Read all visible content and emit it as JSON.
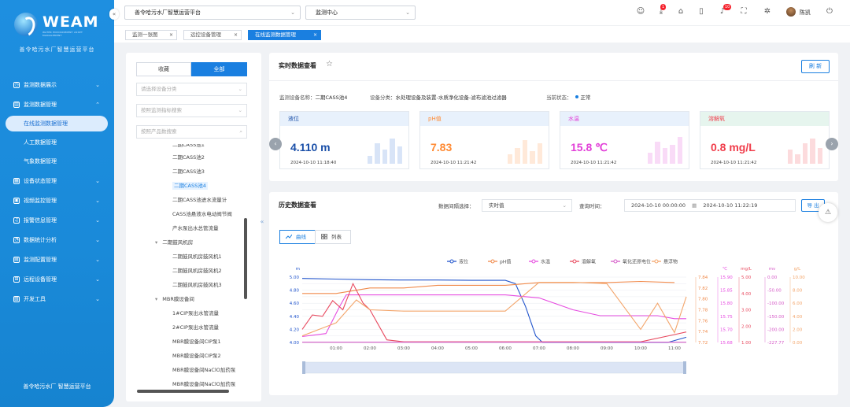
{
  "sidebar": {
    "logo_text": "WEAM",
    "logo_sub": "WATER ENVIRONMENT ASSET MANAGEMENT",
    "brand": "善令哈污水厂智慧运营平台",
    "menu": [
      {
        "label": "监测数据展示",
        "icon": "◷"
      },
      {
        "label": "监测数据管理",
        "icon": "▥",
        "expanded": true,
        "children": [
          "在线监测数据管理",
          "人工数据管理",
          "气象数据管理"
        ]
      },
      {
        "label": "设备状态管理",
        "icon": "▦"
      },
      {
        "label": "视频监控管理",
        "icon": "▣"
      },
      {
        "label": "报警信息管理",
        "icon": "♫"
      },
      {
        "label": "数据统计分析",
        "icon": "◔"
      },
      {
        "label": "监测配置管理",
        "icon": "▤"
      },
      {
        "label": "远程设备管理",
        "icon": "⊞"
      },
      {
        "label": "开发工具",
        "icon": "▧"
      }
    ],
    "active_child": "在线监测数据管理",
    "footer": "善令哈污水厂 智慧运营平台"
  },
  "topbar": {
    "site_select": "善令哈污水厂智慧运营平台",
    "module_select": "监测中心",
    "badge_download": "1",
    "badge_bell": "10",
    "username": "陈凯"
  },
  "tabs": [
    "监测一张图",
    "远控设备管理",
    "在线监测数据管理"
  ],
  "active_tab": "在线监测数据管理",
  "leftpanel": {
    "seg_fav": "收藏",
    "seg_all": "全部",
    "filter1": "请选择设备分类",
    "filter2": "按照监测指标搜索",
    "filter3": "按照产品数搜索",
    "tree": [
      {
        "label": "二期CASS池1",
        "indent": 2,
        "partial": true
      },
      {
        "label": "二期CASS池2",
        "indent": 2
      },
      {
        "label": "二期CASS池3",
        "indent": 2
      },
      {
        "label": "二期CASS池4",
        "indent": 2,
        "selected": true
      },
      {
        "label": "二期CASS池进水流量计",
        "indent": 2
      },
      {
        "label": "CASS池悬液水电动阀节阀",
        "indent": 2
      },
      {
        "label": "产水泵出水总管流量",
        "indent": 2
      },
      {
        "label": "二期鼓风机房",
        "indent": 1,
        "toggle": "▾"
      },
      {
        "label": "二期鼓风机房鼓风机1",
        "indent": 2
      },
      {
        "label": "二期鼓风机房鼓风机2",
        "indent": 2
      },
      {
        "label": "二期鼓风机房鼓风机3",
        "indent": 2
      },
      {
        "label": "MBR膜设备间",
        "indent": 1,
        "toggle": "▾"
      },
      {
        "label": "1#CIP泵出水管流量",
        "indent": 2
      },
      {
        "label": "2#CIP泵出水管流量",
        "indent": 2
      },
      {
        "label": "MBR膜设备间CIP泵1",
        "indent": 2
      },
      {
        "label": "MBR膜设备间CIP泵2",
        "indent": 2
      },
      {
        "label": "MBR膜设备间NaClO加药泵",
        "indent": 2
      },
      {
        "label": "MBR膜设备间NaClO加药泵",
        "indent": 2
      }
    ]
  },
  "realtime": {
    "title": "实时数据查看",
    "refresh": "刷 新",
    "device_label": "监测设备名称：",
    "device_value": "二期CASS池4",
    "category_label": "设备分类：",
    "category_value": "水处理设备及装置-水质净化设备-滤布滤池过滤器",
    "status_label": "当前状态：",
    "status_value": "正常",
    "cards": [
      {
        "name": "液位",
        "value": "4.110 m",
        "time": "2024-10-10 11:18:40",
        "color": "#1a4fa8",
        "head_bg": "#e8f1fc",
        "bar": "#2b6fd6"
      },
      {
        "name": "pH值",
        "value": "7.83",
        "time": "2024-10-10 11:21:42",
        "color": "#ff8a33",
        "head_bg": "#e8f1fc",
        "bar": "#ff8a33"
      },
      {
        "name": "水温",
        "value": "15.8 ℃",
        "time": "2024-10-10 11:21:42",
        "color": "#e23fd8",
        "head_bg": "#e8f1fc",
        "bar": "#e23fd8"
      },
      {
        "name": "溶解氧",
        "value": "0.8 mg/L",
        "time": "2024-10-10 11:21:42",
        "color": "#f03c4a",
        "head_bg": "#e6f5ee",
        "bar": "#f03c4a"
      }
    ]
  },
  "history": {
    "title": "历史数据查看",
    "interval_label": "数据间隔选择：",
    "interval_value": "实时值",
    "query_label": "查询时间：",
    "start": "2024-10-10 00:00:00",
    "end": "2024-10-10 11:22:19",
    "export": "导 出",
    "view_curve": "曲线",
    "view_list": "列表"
  },
  "chart_data": {
    "type": "line",
    "legend": [
      "液位",
      "pH值",
      "水温",
      "溶解氧",
      "氧化还原电位",
      "悬浮物"
    ],
    "x_ticks": [
      "01:00",
      "02:00",
      "03:00",
      "04:00",
      "05:00",
      "06:00",
      "07:00",
      "08:00",
      "09:00",
      "10:00",
      "11:00"
    ],
    "x_range": [
      0,
      11.35
    ],
    "axes": [
      {
        "unit": "m",
        "ticks": [
          "5.00",
          "4.80",
          "4.60",
          "4.40",
          "4.20",
          "4.00"
        ],
        "range": [
          4.0,
          5.0
        ]
      },
      {
        "unit": "",
        "ticks": [
          "7.84",
          "7.82",
          "7.80",
          "7.78",
          "7.76",
          "7.74",
          "7.72"
        ],
        "range": [
          7.72,
          7.84
        ]
      },
      {
        "unit": "℃",
        "ticks": [
          "15.90",
          "15.85",
          "15.80",
          "15.75",
          "15.70",
          "15.68"
        ]
      },
      {
        "unit": "mg/L",
        "ticks": [
          "5.00",
          "4.00",
          "3.00",
          "2.00",
          "1.00"
        ]
      },
      {
        "unit": "mv",
        "ticks": [
          "0.00",
          "-50.00",
          "-100.00",
          "-150.00",
          "-200.00",
          "-227.77"
        ]
      },
      {
        "unit": "g/L",
        "ticks": [
          "10.00",
          "8.00",
          "6.00",
          "4.00",
          "2.00",
          "0.00"
        ]
      }
    ],
    "colors": [
      "#2255cc",
      "#f08a4b",
      "#e64ce0",
      "#e84a5f",
      "#d65cc8",
      "#f3a56b"
    ],
    "series": [
      {
        "name": "液位",
        "points": [
          [
            0,
            4.98
          ],
          [
            1,
            4.97
          ],
          [
            2,
            4.96
          ],
          [
            3,
            4.955
          ],
          [
            4,
            4.955
          ],
          [
            5,
            4.95
          ],
          [
            6,
            4.95
          ],
          [
            6.3,
            4.9
          ],
          [
            6.6,
            4.55
          ],
          [
            6.9,
            4.1
          ],
          [
            7.1,
            4.0
          ],
          [
            8,
            4.0
          ],
          [
            9,
            4.0
          ],
          [
            10,
            4.0
          ],
          [
            10.8,
            4.0
          ],
          [
            11.35,
            4.08
          ]
        ]
      },
      {
        "name": "pH值",
        "points": [
          [
            0,
            7.81
          ],
          [
            0.5,
            7.81
          ],
          [
            1,
            7.81
          ],
          [
            1.5,
            7.815
          ],
          [
            2,
            7.82
          ],
          [
            3,
            7.82
          ],
          [
            4,
            7.825
          ],
          [
            5,
            7.825
          ],
          [
            6,
            7.825
          ],
          [
            7,
            7.83
          ],
          [
            8,
            7.83
          ],
          [
            9,
            7.83
          ],
          [
            10,
            7.832
          ],
          [
            11,
            7.83
          ]
        ]
      },
      {
        "name": "水温",
        "points": [
          [
            0,
            15.7
          ],
          [
            0.7,
            15.71
          ],
          [
            1.1,
            15.8
          ],
          [
            1.3,
            15.84
          ],
          [
            2,
            15.84
          ],
          [
            3,
            15.84
          ],
          [
            4,
            15.84
          ],
          [
            5,
            15.84
          ],
          [
            6,
            15.84
          ],
          [
            7,
            15.83
          ],
          [
            8,
            15.79
          ],
          [
            8.8,
            15.77
          ],
          [
            9.5,
            15.77
          ],
          [
            10.5,
            15.77
          ],
          [
            11,
            15.76
          ],
          [
            11.35,
            15.76
          ]
        ]
      },
      {
        "name": "溶解氧",
        "points": [
          [
            0,
            1.0
          ],
          [
            0.3,
            2.1
          ],
          [
            0.6,
            2.0
          ],
          [
            0.9,
            3.2
          ],
          [
            1.2,
            2.5
          ],
          [
            1.5,
            4.5
          ],
          [
            1.8,
            3.0
          ],
          [
            2.0,
            2.5
          ],
          [
            2.5,
            0.2
          ],
          [
            3,
            0.05
          ],
          [
            4,
            0.05
          ],
          [
            5,
            0.05
          ],
          [
            6,
            0.05
          ],
          [
            7,
            0.05
          ],
          [
            8,
            0.05
          ],
          [
            9,
            0.05
          ],
          [
            10,
            0.05
          ],
          [
            11,
            0.6
          ],
          [
            11.35,
            0.8
          ]
        ]
      },
      {
        "name": "氧化还原电位",
        "points": [
          [
            0,
            -227
          ],
          [
            11.35,
            -227
          ]
        ]
      },
      {
        "name": "悬浮物",
        "points": [
          [
            0,
            1.0
          ],
          [
            0.5,
            2.0
          ],
          [
            1,
            3.0
          ],
          [
            1.6,
            6.5
          ],
          [
            2,
            5.0
          ],
          [
            3,
            4.8
          ],
          [
            4,
            4.8
          ],
          [
            5,
            4.8
          ],
          [
            6,
            4.8
          ],
          [
            7,
            9.2
          ],
          [
            8,
            9.2
          ],
          [
            9,
            9.0
          ],
          [
            10,
            2.0
          ],
          [
            10.5,
            6.0
          ],
          [
            11,
            1.5
          ],
          [
            11.35,
            7.0
          ]
        ]
      }
    ]
  }
}
